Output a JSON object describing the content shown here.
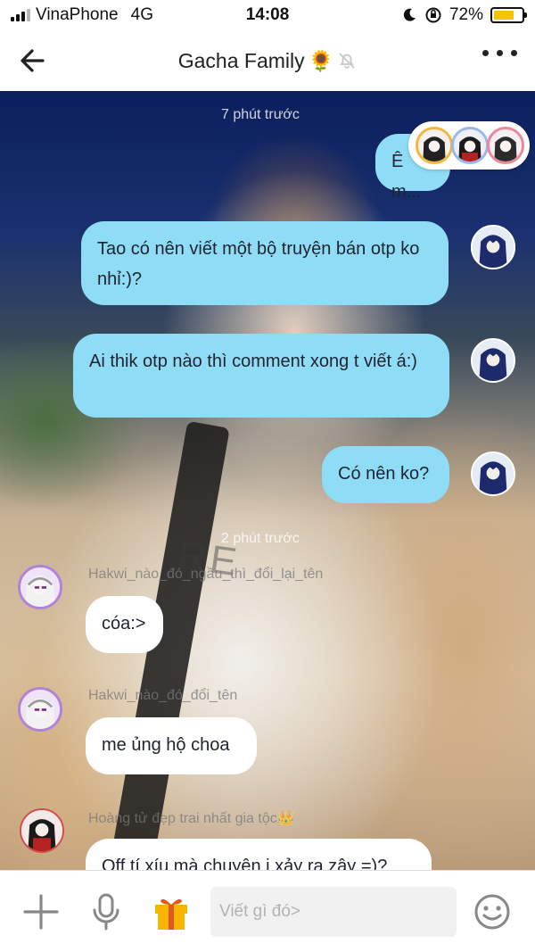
{
  "status_bar": {
    "carrier": "VinaPhone",
    "network": "4G",
    "time": "14:08",
    "battery": "72%",
    "battery_level": 0.72
  },
  "header": {
    "title": "Gacha Family",
    "title_emoji": "🌻"
  },
  "chat": {
    "timestamps": [
      "7 phút trước",
      "2 phút trước"
    ],
    "my_messages": [
      "Ê m...",
      "Tao có nên viết một bộ truyện bán otp ko nhỉ:)?",
      "Ai thik otp nào thì comment xong t viết á:)",
      "Có nên ko?"
    ],
    "others": [
      {
        "sender": "Hakwi_nào_đó_ngầu_thì_đổi_lại_tên",
        "text": "cóa:>"
      },
      {
        "sender": "Hakwi_nào_đó_đổi_tên",
        "text": "me ủng hộ choa"
      },
      {
        "sender": "Hoàng tử đẹp trai nhất gia tộc",
        "sender_emoji": "👑",
        "text": "Off tí xíu mà chuyện j xảy ra zậy =)?"
      }
    ]
  },
  "composer": {
    "placeholder": "Viết gì đó>"
  },
  "icons": [
    "back-arrow-icon",
    "mute-bell-icon",
    "more-options-icon",
    "plus-icon",
    "microphone-icon",
    "gift-icon",
    "emoji-icon"
  ]
}
